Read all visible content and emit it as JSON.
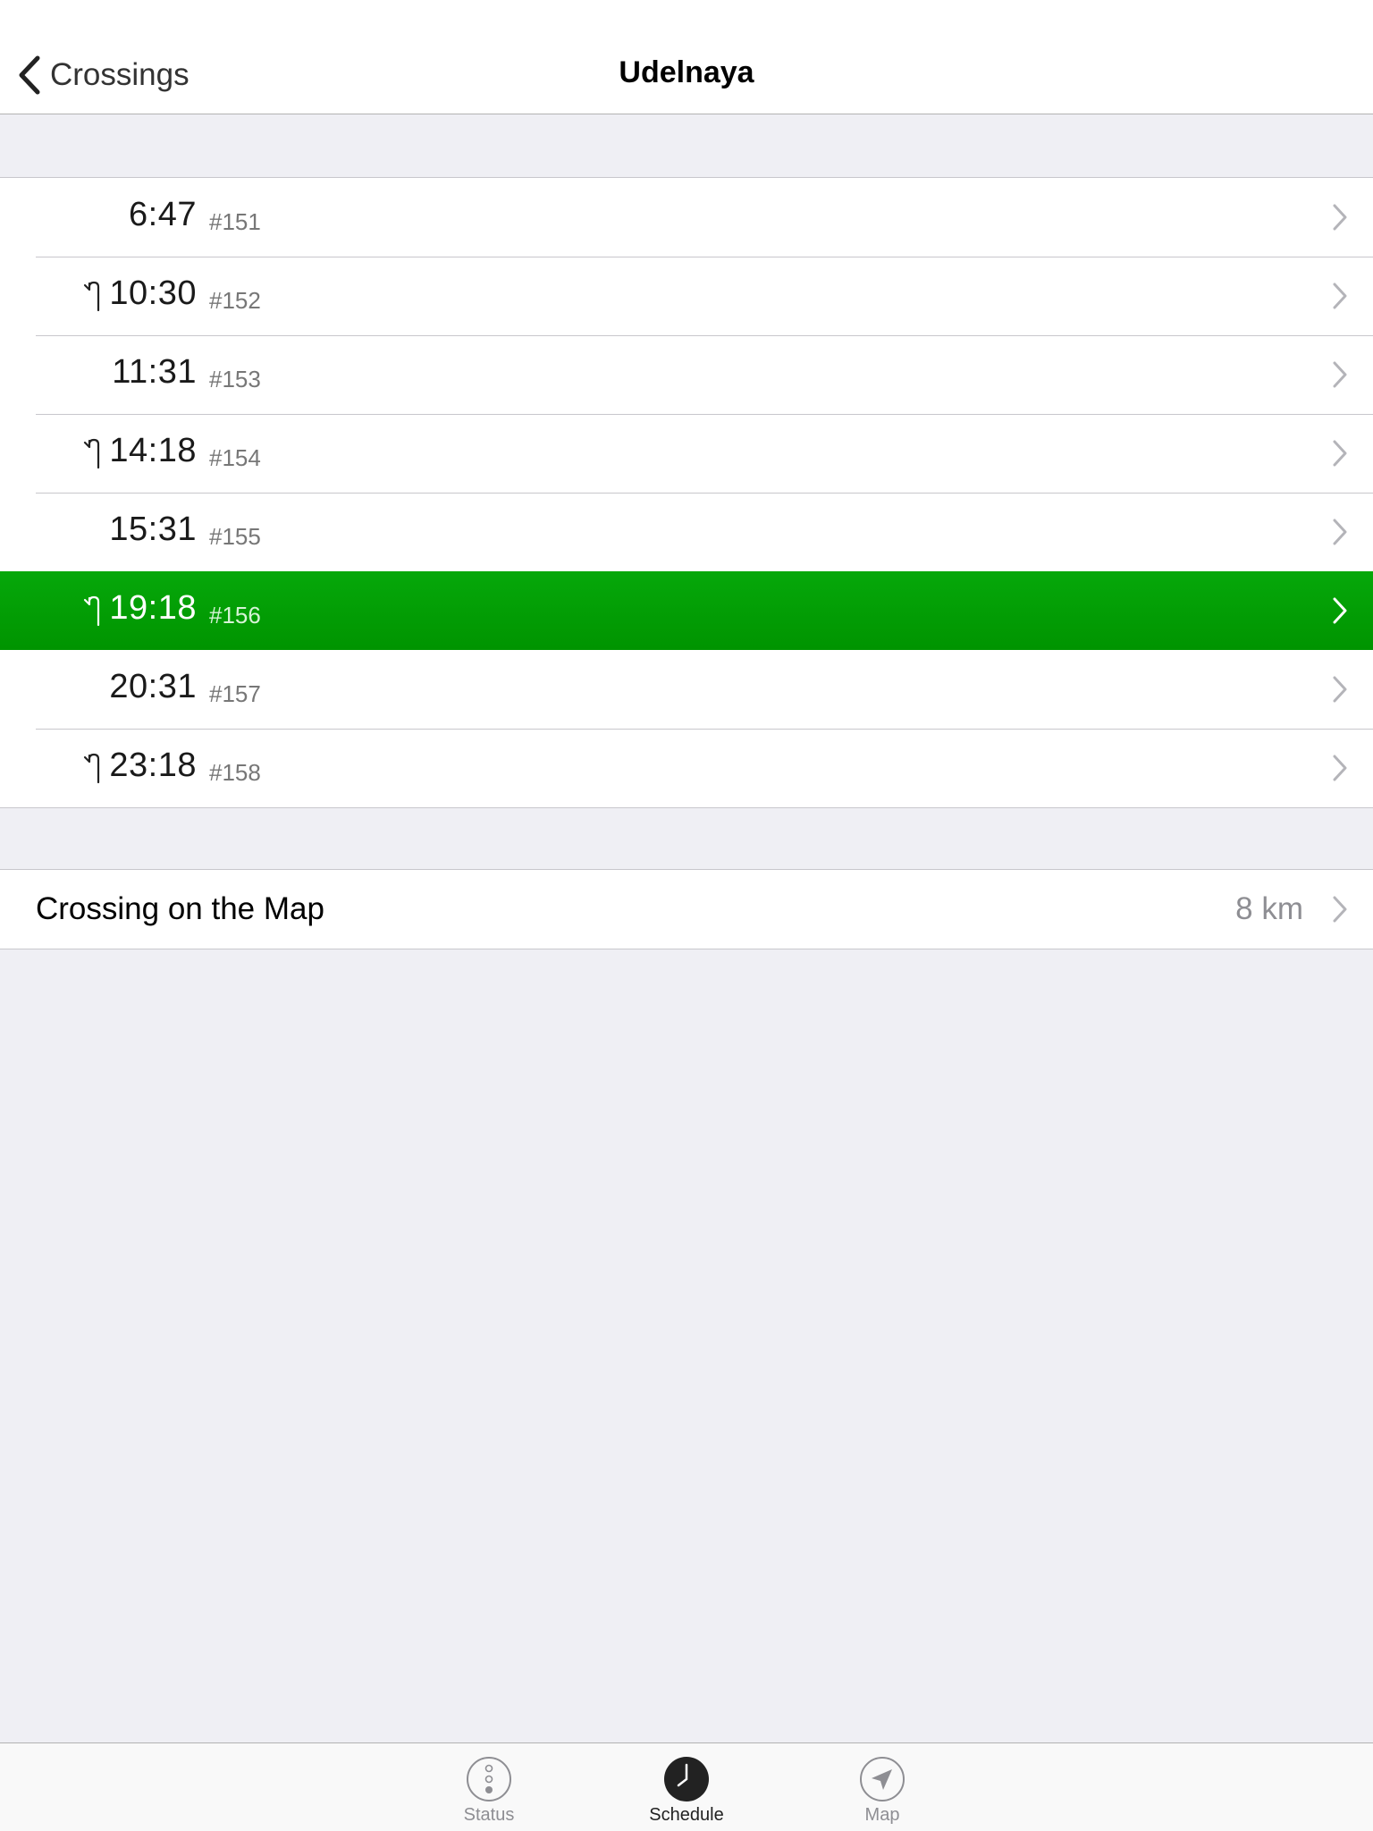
{
  "nav": {
    "back_label": "Crossings",
    "title": "Udelnaya"
  },
  "schedule": [
    {
      "time": "6:47",
      "number": "#151",
      "turn_icon": false,
      "selected": false
    },
    {
      "time": "10:30",
      "number": "#152",
      "turn_icon": true,
      "selected": false
    },
    {
      "time": "11:31",
      "number": "#153",
      "turn_icon": false,
      "selected": false
    },
    {
      "time": "14:18",
      "number": "#154",
      "turn_icon": true,
      "selected": false
    },
    {
      "time": "15:31",
      "number": "#155",
      "turn_icon": false,
      "selected": false
    },
    {
      "time": "19:18",
      "number": "#156",
      "turn_icon": true,
      "selected": true
    },
    {
      "time": "20:31",
      "number": "#157",
      "turn_icon": false,
      "selected": false
    },
    {
      "time": "23:18",
      "number": "#158",
      "turn_icon": true,
      "selected": false
    }
  ],
  "map_row": {
    "label": "Crossing on the Map",
    "detail": "8 km"
  },
  "tabs": [
    {
      "label": "Status",
      "icon": "traffic-light-icon",
      "active": false
    },
    {
      "label": "Schedule",
      "icon": "clock-icon",
      "active": true
    },
    {
      "label": "Map",
      "icon": "location-arrow-icon",
      "active": false
    }
  ],
  "colors": {
    "selected_row": "#06a80a",
    "background": "#efeff4",
    "secondary_text": "#8e8e93"
  }
}
